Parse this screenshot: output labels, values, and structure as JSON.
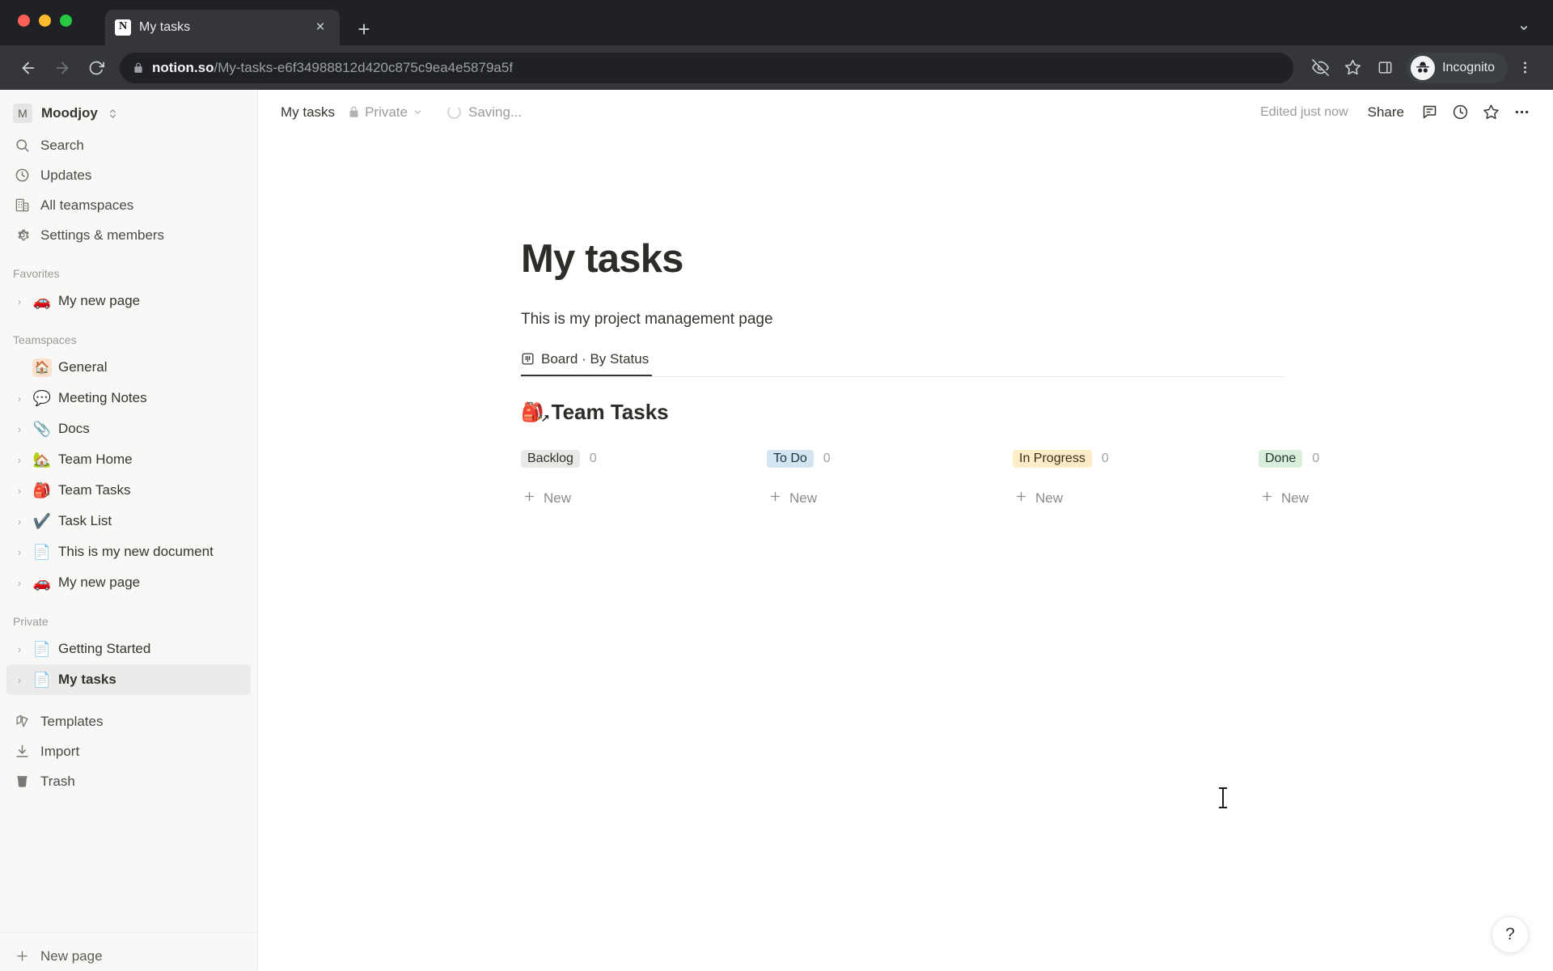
{
  "browser": {
    "tab": {
      "title": "My tasks",
      "favicon_letter": "N",
      "favicon_name": "notion-favicon"
    },
    "new_tab_label": "+",
    "tab_close_label": "×",
    "tab_list_label": "⌄",
    "url": {
      "host": "notion.so",
      "path": "/My-tasks-e6f34988812d420c875c9ea4e5879a5f"
    },
    "profile": {
      "label": "Incognito"
    },
    "icons": {
      "back": "back-arrow-icon",
      "forward": "forward-arrow-icon",
      "reload": "reload-icon",
      "lock": "lock-icon",
      "tracking_protection": "eye-slash-icon",
      "bookmark": "star-icon",
      "side_panel": "side-panel-icon",
      "menu": "three-dot-menu-icon"
    }
  },
  "sidebar": {
    "workspace": {
      "name": "Moodjoy",
      "avatar_letter": "M"
    },
    "nav": [
      {
        "label": "Search",
        "icon": "search-icon"
      },
      {
        "label": "Updates",
        "icon": "clock-icon"
      },
      {
        "label": "All teamspaces",
        "icon": "building-icon"
      },
      {
        "label": "Settings & members",
        "icon": "gear-icon"
      }
    ],
    "sections": [
      {
        "title": "Favorites",
        "items": [
          {
            "label": "My new page",
            "emoji": "🚗",
            "has_chevron": true
          }
        ]
      },
      {
        "title": "Teamspaces",
        "items": [
          {
            "label": "General",
            "emoji": "🏠",
            "has_chevron": false,
            "boxed": true
          },
          {
            "label": "Meeting Notes",
            "emoji": "💬",
            "has_chevron": true
          },
          {
            "label": "Docs",
            "emoji": "📎",
            "has_chevron": true
          },
          {
            "label": "Team Home",
            "emoji": "🏡",
            "has_chevron": true
          },
          {
            "label": "Team Tasks",
            "emoji": "🎒",
            "has_chevron": true
          },
          {
            "label": "Task List",
            "emoji": "✔️",
            "has_chevron": true
          },
          {
            "label": "This is my new document",
            "emoji": "📄",
            "has_chevron": true
          },
          {
            "label": "My new page",
            "emoji": "🚗",
            "has_chevron": true
          }
        ]
      },
      {
        "title": "Private",
        "items": [
          {
            "label": "Getting Started",
            "emoji": "📄",
            "has_chevron": true,
            "active": false
          },
          {
            "label": "My tasks",
            "emoji": "📄",
            "has_chevron": true,
            "active": true
          }
        ]
      }
    ],
    "utilities": [
      {
        "label": "Templates",
        "icon": "templates-icon"
      },
      {
        "label": "Import",
        "icon": "import-download-icon"
      },
      {
        "label": "Trash",
        "icon": "trash-icon"
      }
    ],
    "footer": {
      "new_page_label": "New page",
      "new_page_icon": "plus-icon"
    }
  },
  "topbar": {
    "breadcrumb": "My tasks",
    "privacy_label": "Private",
    "privacy_icon": "lock-icon",
    "privacy_chevron": "⌄",
    "saving_status": "Saving...",
    "edited_status": "Edited just now",
    "share_label": "Share",
    "actions": [
      {
        "icon": "comment-icon"
      },
      {
        "icon": "history-clock-icon"
      },
      {
        "icon": "star-favorite-icon"
      },
      {
        "icon": "more-options-icon"
      }
    ]
  },
  "page": {
    "title": "My tasks",
    "description": "This is my project management page",
    "view_tabs": [
      {
        "label": "Board · By Status",
        "icon": "board-view-icon",
        "active": true
      }
    ],
    "database": {
      "title": "Team Tasks",
      "emoji": "🎒",
      "link_arrow": "↗",
      "new_label": "New",
      "new_icon": "plus-icon",
      "columns": [
        {
          "name": "Backlog",
          "count": "0",
          "color": "#e9e9e7",
          "text_color": "#32302c"
        },
        {
          "name": "To Do",
          "count": "0",
          "color": "#d3e5ef",
          "text_color": "#183347"
        },
        {
          "name": "In Progress",
          "count": "0",
          "color": "#fdecc8",
          "text_color": "#402c1b"
        },
        {
          "name": "Done",
          "count": "0",
          "color": "#dbeddb",
          "text_color": "#1c3829"
        }
      ]
    }
  },
  "help": {
    "label": "?"
  }
}
